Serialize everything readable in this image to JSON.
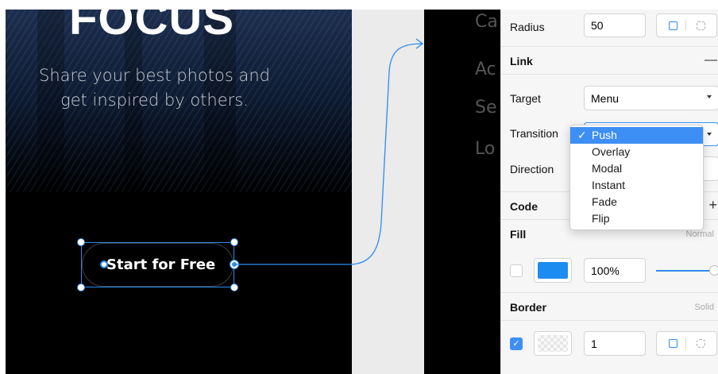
{
  "hero": {
    "title": "FOCUS",
    "subtitle_line1": "Share your best photos and",
    "subtitle_line2": "get inspired by others."
  },
  "cta": {
    "label": "Start for Free"
  },
  "menu_preview": {
    "items": [
      "Ca",
      "Ac",
      "Se",
      "Lo"
    ]
  },
  "inspector": {
    "radius": {
      "label": "Radius",
      "value": "50"
    },
    "link": {
      "title": "Link",
      "collapse_symbol": "—",
      "target_label": "Target",
      "target_value": "Menu",
      "transition_label": "Transition",
      "direction_label": "Direction"
    },
    "code": {
      "title": "Code",
      "add_symbol": "+"
    },
    "fill": {
      "title": "Fill",
      "blend": "Normal",
      "color": "#1d8cf0",
      "opacity": "100%",
      "slider_level": 1.0
    },
    "border": {
      "title": "Border",
      "style": "Solid",
      "width": "1",
      "checked": true
    }
  },
  "dropdown": {
    "check": "✓",
    "options": [
      "Push",
      "Overlay",
      "Modal",
      "Instant",
      "Fade",
      "Flip"
    ],
    "selected": "Push"
  },
  "colors": {
    "accent": "#2d8cf0",
    "selected_option": "#3d8ff5"
  }
}
